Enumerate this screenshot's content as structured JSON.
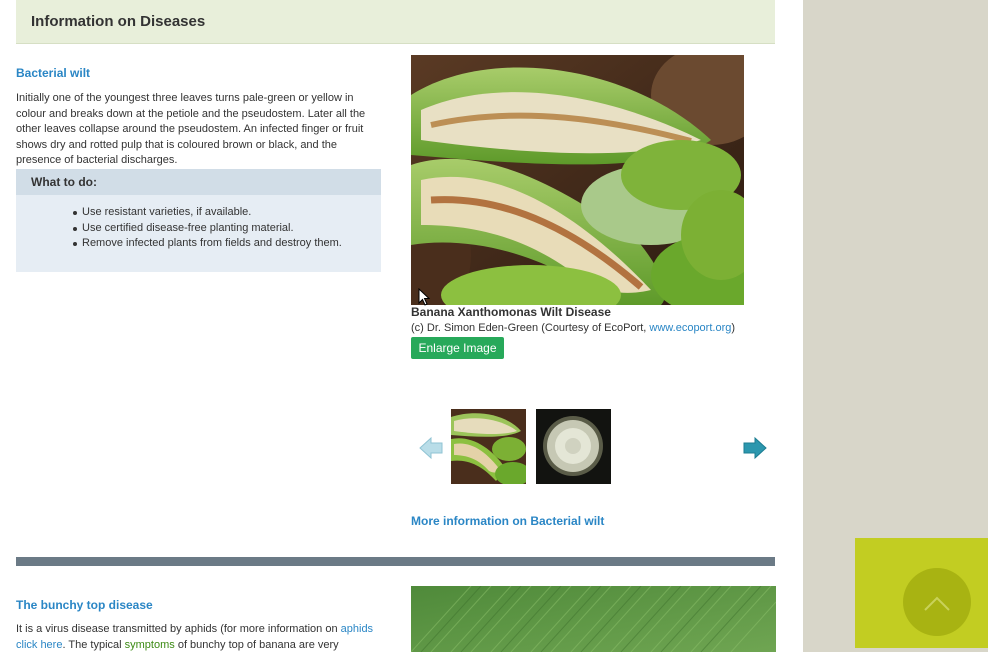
{
  "header": {
    "title": "Information on Diseases"
  },
  "disease1": {
    "title": "Bacterial wilt",
    "description": "Initially one of the youngest three leaves turns pale-green or yellow in colour and breaks down at the petiole and the pseudostem. Later all the other leaves collapse around the pseudostem. An infected finger or fruit shows dry and rotted pulp that is coloured brown or black, and the presence of bacterial discharges.",
    "todo_title": "What to do:",
    "todo_items": [
      "Use resistant varieties, if available.",
      "Use certified disease-free planting material.",
      "Remove infected plants from fields and destroy them."
    ],
    "image_caption": "Banana Xanthomonas Wilt Disease",
    "credit_prefix": "(c) Dr. Simon Eden-Green (Courtesy of EcoPort, ",
    "credit_link": "www.ecoport.org",
    "credit_suffix": ")",
    "enlarge_label": "Enlarge Image",
    "more_info": "More information on Bacterial wilt"
  },
  "disease2": {
    "title": "The bunchy top disease",
    "desc_part1": "It is a virus disease transmitted by aphids (for more information on ",
    "desc_link1": "aphids",
    "desc_link2": "click here",
    "desc_part2": ". The typical ",
    "desc_highlight": "symptoms",
    "desc_part3": " of bunchy top of banana are very"
  },
  "icons": {
    "prev": "arrow-left-icon",
    "next": "arrow-right-icon",
    "back_to_top": "chevron-up-icon"
  },
  "colors": {
    "link": "#2a86c5",
    "button_green": "#27a95a",
    "header_bg": "#e8efda",
    "back_to_top": "#c2cd22"
  }
}
